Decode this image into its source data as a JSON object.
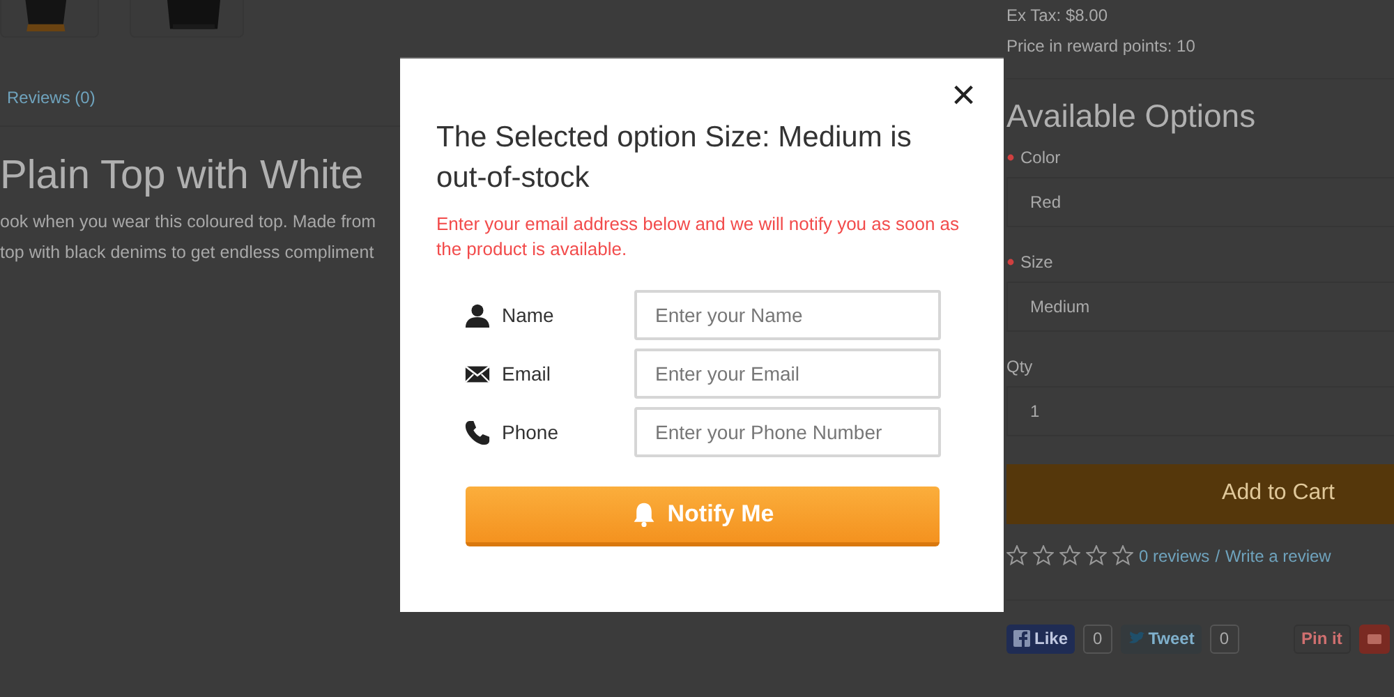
{
  "background_page": {
    "reviews_tab": "Reviews (0)",
    "product": {
      "title": "Plain Top with White",
      "description": [
        "ook when you wear this coloured top. Made from",
        "top with black denims to get endless compliment"
      ]
    },
    "price": {
      "ex_tax": "Ex Tax: $8.00",
      "reward_points": "Price in reward points: 10"
    },
    "options": {
      "heading": "Available Options",
      "fields": [
        {
          "label": "Color",
          "required": true,
          "value": "Red"
        },
        {
          "label": "Size",
          "required": true,
          "value": "Medium"
        },
        {
          "label": "Qty",
          "required": false,
          "value": "1"
        }
      ]
    },
    "add_to_cart": "Add to Cart",
    "rating": {
      "stars": 0,
      "reviews_link": "0 reviews",
      "separator": "/",
      "write_link": "Write a review"
    },
    "social": [
      {
        "kind": "facebook",
        "label": "Like",
        "count": "0"
      },
      {
        "kind": "twitter",
        "label": "Tweet",
        "count": "0"
      },
      {
        "kind": "pinterest",
        "label": "Pin it"
      },
      {
        "kind": "google"
      }
    ]
  },
  "modal": {
    "close": "×",
    "title": "The Selected option Size: Medium is out-of-stock",
    "message": "Enter your email address below and we will notify you as soon as the product is available.",
    "fields": [
      {
        "kind": "name",
        "label": "Name",
        "placeholder": "Enter your Name"
      },
      {
        "kind": "email",
        "label": "Email",
        "placeholder": "Enter your Email"
      },
      {
        "kind": "phone",
        "label": "Phone",
        "placeholder": "Enter your Phone Number"
      }
    ],
    "submit": "Notify Me"
  }
}
